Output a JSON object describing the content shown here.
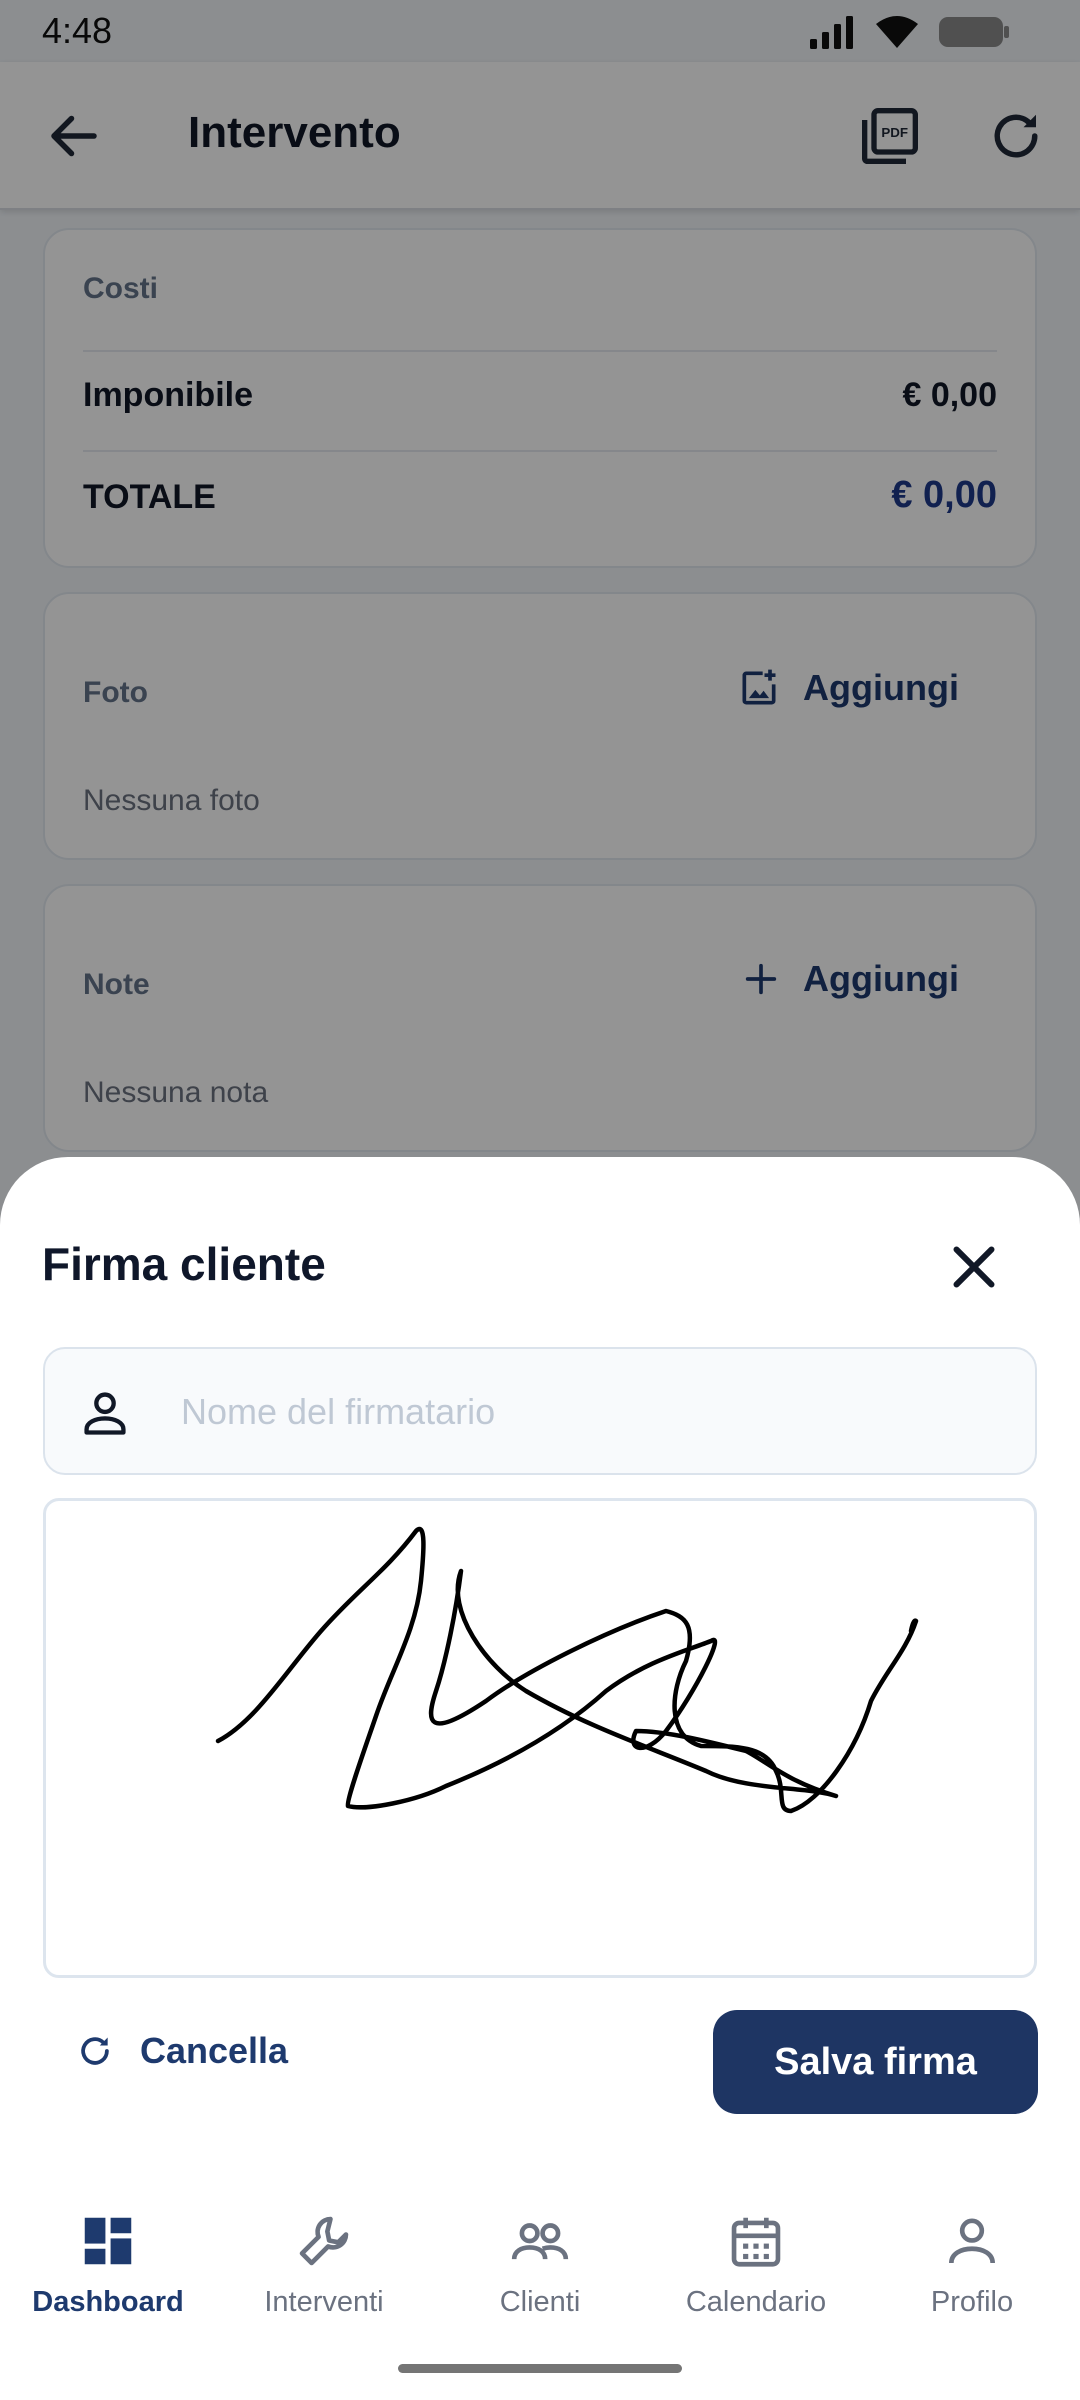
{
  "status_bar": {
    "time": "4:48"
  },
  "header": {
    "title": "Intervento"
  },
  "costs_card": {
    "label": "Costi",
    "taxable_label": "Imponibile",
    "taxable_value": "€ 0,00",
    "total_label": "TOTALE",
    "total_value": "€ 0,00"
  },
  "photo_card": {
    "label": "Foto",
    "add_label": "Aggiungi",
    "empty_text": "Nessuna foto"
  },
  "notes_card": {
    "label": "Note",
    "add_label": "Aggiungi",
    "empty_text": "Nessuna nota"
  },
  "signature_sheet": {
    "title": "Firma cliente",
    "name_placeholder": "Nome del firmatario",
    "name_value": "",
    "clear_label": "Cancella",
    "save_label": "Salva firma"
  },
  "bottom_nav": {
    "items": [
      {
        "label": "Dashboard",
        "icon": "dashboard-icon",
        "active": true
      },
      {
        "label": "Interventi",
        "icon": "wrench-icon",
        "active": false
      },
      {
        "label": "Clienti",
        "icon": "people-icon",
        "active": false
      },
      {
        "label": "Calendario",
        "icon": "calendar-icon",
        "active": false
      },
      {
        "label": "Profilo",
        "icon": "person-icon",
        "active": false
      }
    ]
  },
  "colors": {
    "primary": "#1e3563",
    "accent_text": "#1e3a6e",
    "scrim": "rgba(0,0,0,0.42)",
    "muted_text": "#6b7280"
  }
}
